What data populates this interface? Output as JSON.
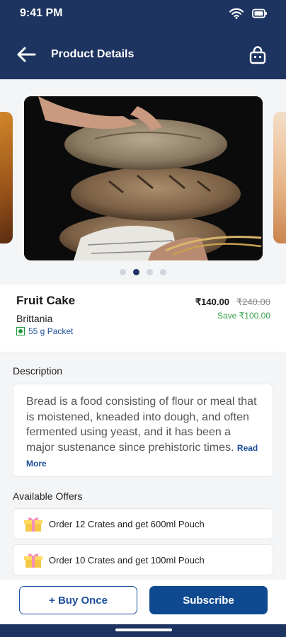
{
  "status": {
    "time": "9:41 PM"
  },
  "nav": {
    "title": "Product Details"
  },
  "carousel": {
    "slide_count": 4,
    "active_index": 1
  },
  "product": {
    "name": "Fruit Cake",
    "brand": "Brittania",
    "pack_size": "55 g Packet",
    "price": "₹140.00",
    "mrp": "₹240.00",
    "savings": "Save ₹100.00"
  },
  "description": {
    "heading": "Description",
    "text": "Bread is a food consisting of flour or meal that is moistened, kneaded into dough, and often fermented using yeast, and it has been a major sustenance since prehistoric times.",
    "read_more": "Read More"
  },
  "offers": {
    "heading": "Available Offers",
    "items": [
      {
        "text": "Order 12 Crates and get 600ml Pouch"
      },
      {
        "text": "Order 10 Crates and get 100ml Pouch"
      }
    ]
  },
  "actions": {
    "buy_once": "+ Buy Once",
    "subscribe": "Subscribe"
  },
  "colors": {
    "header": "#1d3461",
    "accent": "#0f4a91",
    "link": "#1d4e9a",
    "savings": "#3aa14a",
    "veg": "#1e9e3e"
  },
  "icons": {
    "back": "arrow-left-icon",
    "cart": "basket-icon",
    "wifi": "wifi-icon",
    "battery": "battery-icon",
    "veg": "veg-mark-icon",
    "offer": "gift-icon"
  }
}
